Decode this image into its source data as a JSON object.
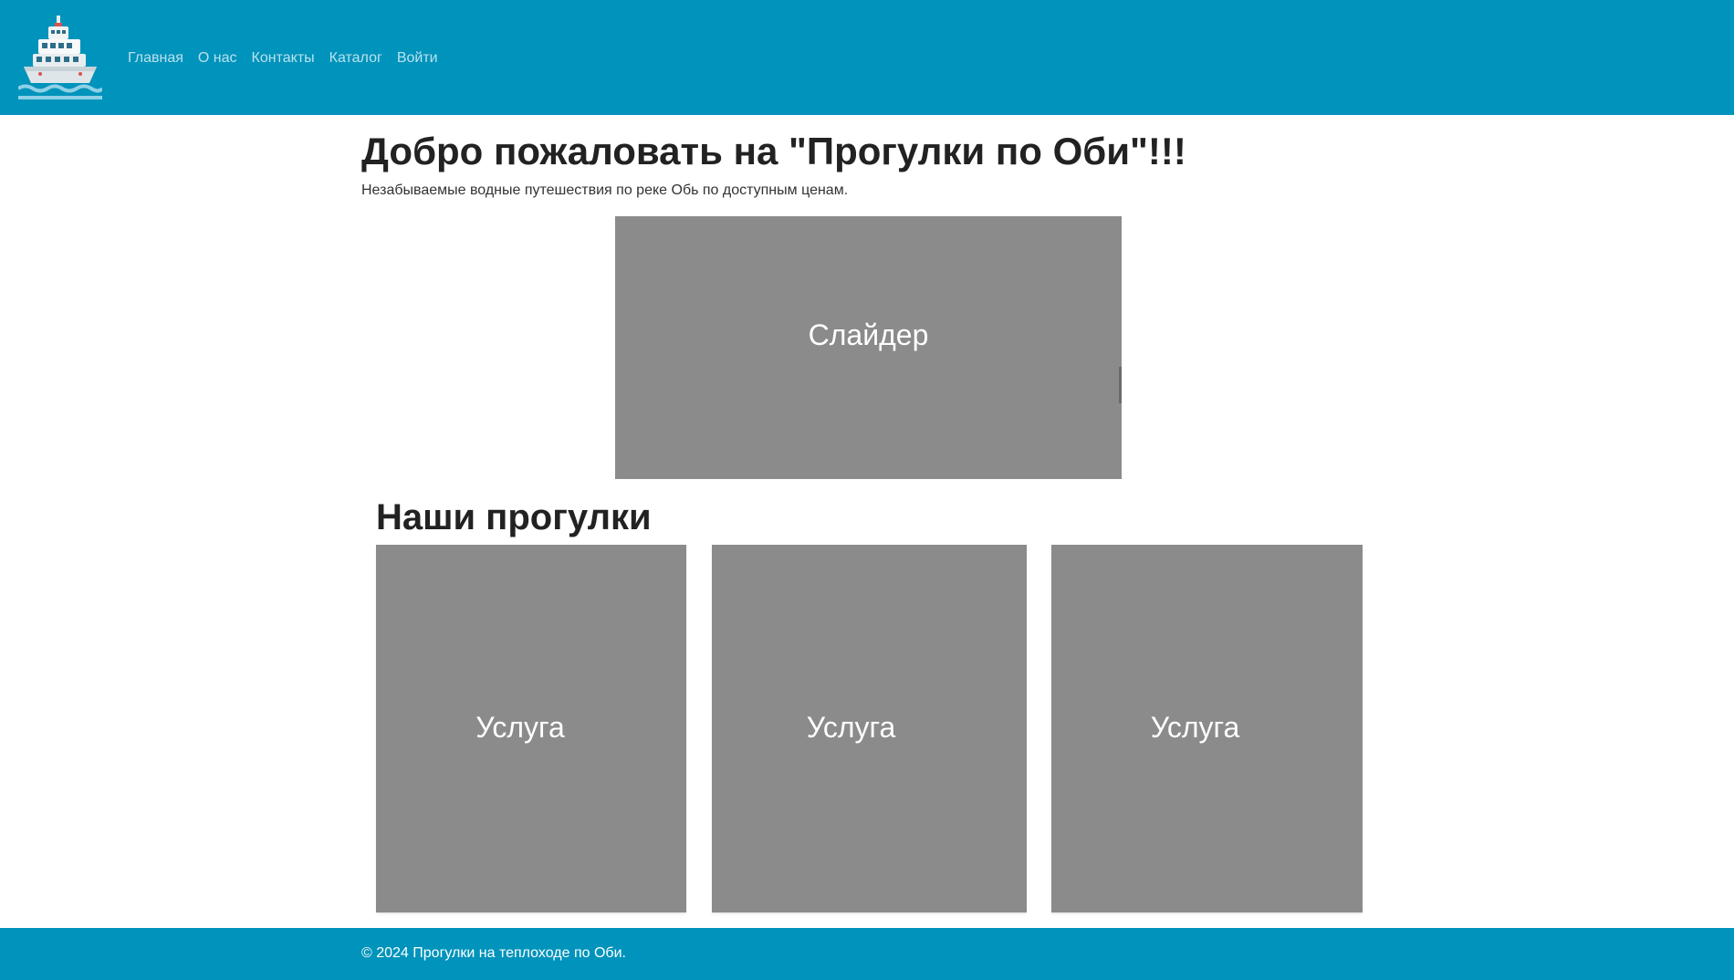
{
  "header": {
    "logo_icon": "ship-icon",
    "nav": [
      {
        "label": "Главная"
      },
      {
        "label": "О нас"
      },
      {
        "label": "Контакты"
      },
      {
        "label": "Каталог"
      },
      {
        "label": "Войти"
      }
    ]
  },
  "hero": {
    "title": "Добро пожаловать на \"Прогулки по Оби\"!!!",
    "subtitle": "Незабываемые водные путешествия по реке Обь по доступным ценам."
  },
  "slider": {
    "label": "Слайдер"
  },
  "services": {
    "title": "Наши прогулки",
    "items": [
      {
        "label": "Услуга"
      },
      {
        "label": "Услуга"
      },
      {
        "label": "Услуга"
      }
    ]
  },
  "footer": {
    "text": "© 2024 Прогулки на теплоходе по Оби."
  },
  "colors": {
    "brand": "#0093BB",
    "placeholder": "#8B8B8B",
    "nav_link": "#B9E2EF"
  }
}
